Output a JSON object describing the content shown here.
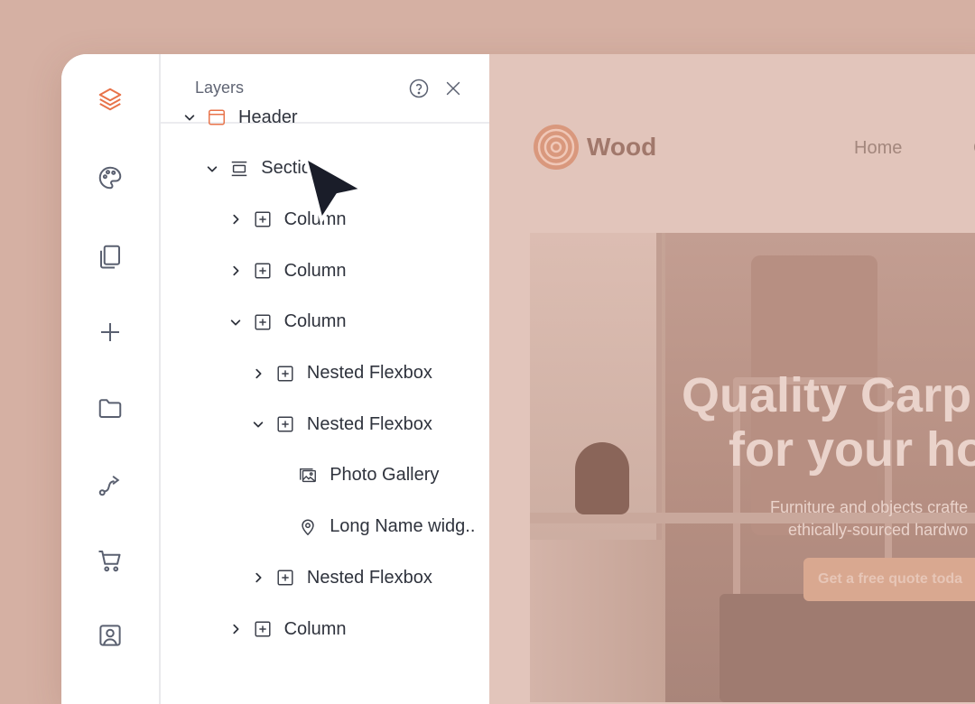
{
  "panel": {
    "title": "Layers"
  },
  "tree": [
    {
      "label": "Header",
      "depth": 0,
      "expanded": true,
      "icon": "header-icon"
    },
    {
      "label": "Section",
      "depth": 1,
      "expanded": true,
      "icon": "section-icon"
    },
    {
      "label": "Column",
      "depth": 2,
      "expanded": false,
      "icon": "column-icon"
    },
    {
      "label": "Column",
      "depth": 2,
      "expanded": false,
      "icon": "column-icon"
    },
    {
      "label": "Column",
      "depth": 2,
      "expanded": true,
      "icon": "column-icon"
    },
    {
      "label": "Nested Flexbox",
      "depth": 3,
      "expanded": false,
      "icon": "flexbox-icon"
    },
    {
      "label": "Nested Flexbox",
      "depth": 3,
      "expanded": true,
      "icon": "flexbox-icon"
    },
    {
      "label": "Photo Gallery",
      "depth": 4,
      "expanded": null,
      "icon": "gallery-icon"
    },
    {
      "label": "Long Name widg..",
      "depth": 4,
      "expanded": null,
      "icon": "location-pin-icon"
    },
    {
      "label": "Nested Flexbox",
      "depth": 3,
      "expanded": false,
      "icon": "flexbox-icon"
    },
    {
      "label": "Column",
      "depth": 2,
      "expanded": false,
      "icon": "column-icon"
    }
  ],
  "rail": [
    {
      "icon": "layers-icon",
      "active": true
    },
    {
      "icon": "palette-icon",
      "active": false
    },
    {
      "icon": "pages-icon",
      "active": false
    },
    {
      "icon": "plus-icon",
      "active": false
    },
    {
      "icon": "folder-icon",
      "active": false
    },
    {
      "icon": "route-icon",
      "active": false
    },
    {
      "icon": "cart-icon",
      "active": false
    },
    {
      "icon": "user-card-icon",
      "active": false
    }
  ],
  "preview": {
    "brand": "Wood",
    "nav": [
      "Home",
      "C"
    ],
    "hero_title_1": "Quality Carp",
    "hero_title_2": "for your ho",
    "hero_sub_1": "Furniture and objects crafte",
    "hero_sub_2": "ethically-sourced hardwo",
    "hero_cta": "Get a free quote toda"
  },
  "colors": {
    "accent": "#e8734a",
    "background": "#d5b0a3",
    "text": "#2f333d"
  }
}
